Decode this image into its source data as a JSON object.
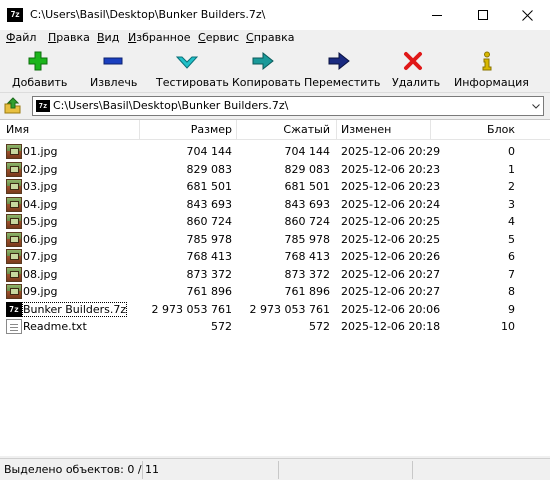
{
  "window": {
    "title": "C:\\Users\\Basil\\Desktop\\Bunker Builders.7z\\",
    "app_icon_text": "7z"
  },
  "menu": [
    {
      "accel": "Ф",
      "rest": "айл"
    },
    {
      "accel": "П",
      "rest": "равка"
    },
    {
      "accel": "В",
      "rest": "ид"
    },
    {
      "accel": "И",
      "rest": "збранное"
    },
    {
      "accel": "С",
      "rest": "ервис"
    },
    {
      "accel": "С",
      "rest": "правка"
    }
  ],
  "toolbar": {
    "add": "Добавить",
    "extract": "Извлечь",
    "test": "Тестировать",
    "copy": "Копировать",
    "move": "Переместить",
    "delete": "Удалить",
    "info": "Информация"
  },
  "address": {
    "path": "C:\\Users\\Basil\\Desktop\\Bunker Builders.7z\\"
  },
  "columns": {
    "name": "Имя",
    "size": "Размер",
    "packed": "Сжатый",
    "modified": "Изменен",
    "block": "Блок"
  },
  "files": [
    {
      "icon": "jpg",
      "name": "01.jpg",
      "size": "704 144",
      "packed": "704 144",
      "modified": "2025-12-06 20:29",
      "block": "0"
    },
    {
      "icon": "jpg",
      "name": "02.jpg",
      "size": "829 083",
      "packed": "829 083",
      "modified": "2025-12-06 20:23",
      "block": "1"
    },
    {
      "icon": "jpg",
      "name": "03.jpg",
      "size": "681 501",
      "packed": "681 501",
      "modified": "2025-12-06 20:23",
      "block": "2"
    },
    {
      "icon": "jpg",
      "name": "04.jpg",
      "size": "843 693",
      "packed": "843 693",
      "modified": "2025-12-06 20:24",
      "block": "3"
    },
    {
      "icon": "jpg",
      "name": "05.jpg",
      "size": "860 724",
      "packed": "860 724",
      "modified": "2025-12-06 20:25",
      "block": "4"
    },
    {
      "icon": "jpg",
      "name": "06.jpg",
      "size": "785 978",
      "packed": "785 978",
      "modified": "2025-12-06 20:25",
      "block": "5"
    },
    {
      "icon": "jpg",
      "name": "07.jpg",
      "size": "768 413",
      "packed": "768 413",
      "modified": "2025-12-06 20:26",
      "block": "6"
    },
    {
      "icon": "jpg",
      "name": "08.jpg",
      "size": "873 372",
      "packed": "873 372",
      "modified": "2025-12-06 20:27",
      "block": "7"
    },
    {
      "icon": "jpg",
      "name": "09.jpg",
      "size": "761 896",
      "packed": "761 896",
      "modified": "2025-12-06 20:27",
      "block": "8"
    },
    {
      "icon": "7z",
      "name": "Bunker Builders.7z",
      "size": "2 973 053 761",
      "packed": "2 973 053 761",
      "modified": "2025-12-06 20:06",
      "block": "9"
    },
    {
      "icon": "txt",
      "name": "Readme.txt",
      "size": "572",
      "packed": "572",
      "modified": "2025-12-06 20:18",
      "block": "10"
    }
  ],
  "status": {
    "selected": "Выделено объектов: 0 / 11"
  },
  "colors": {
    "add": "#1bb51b",
    "extract": "#1a3fbf",
    "test": "#20c0c8",
    "copy": "#1a9a9a",
    "move": "#1a2a80",
    "delete": "#e01818",
    "info": "#d8b800"
  }
}
